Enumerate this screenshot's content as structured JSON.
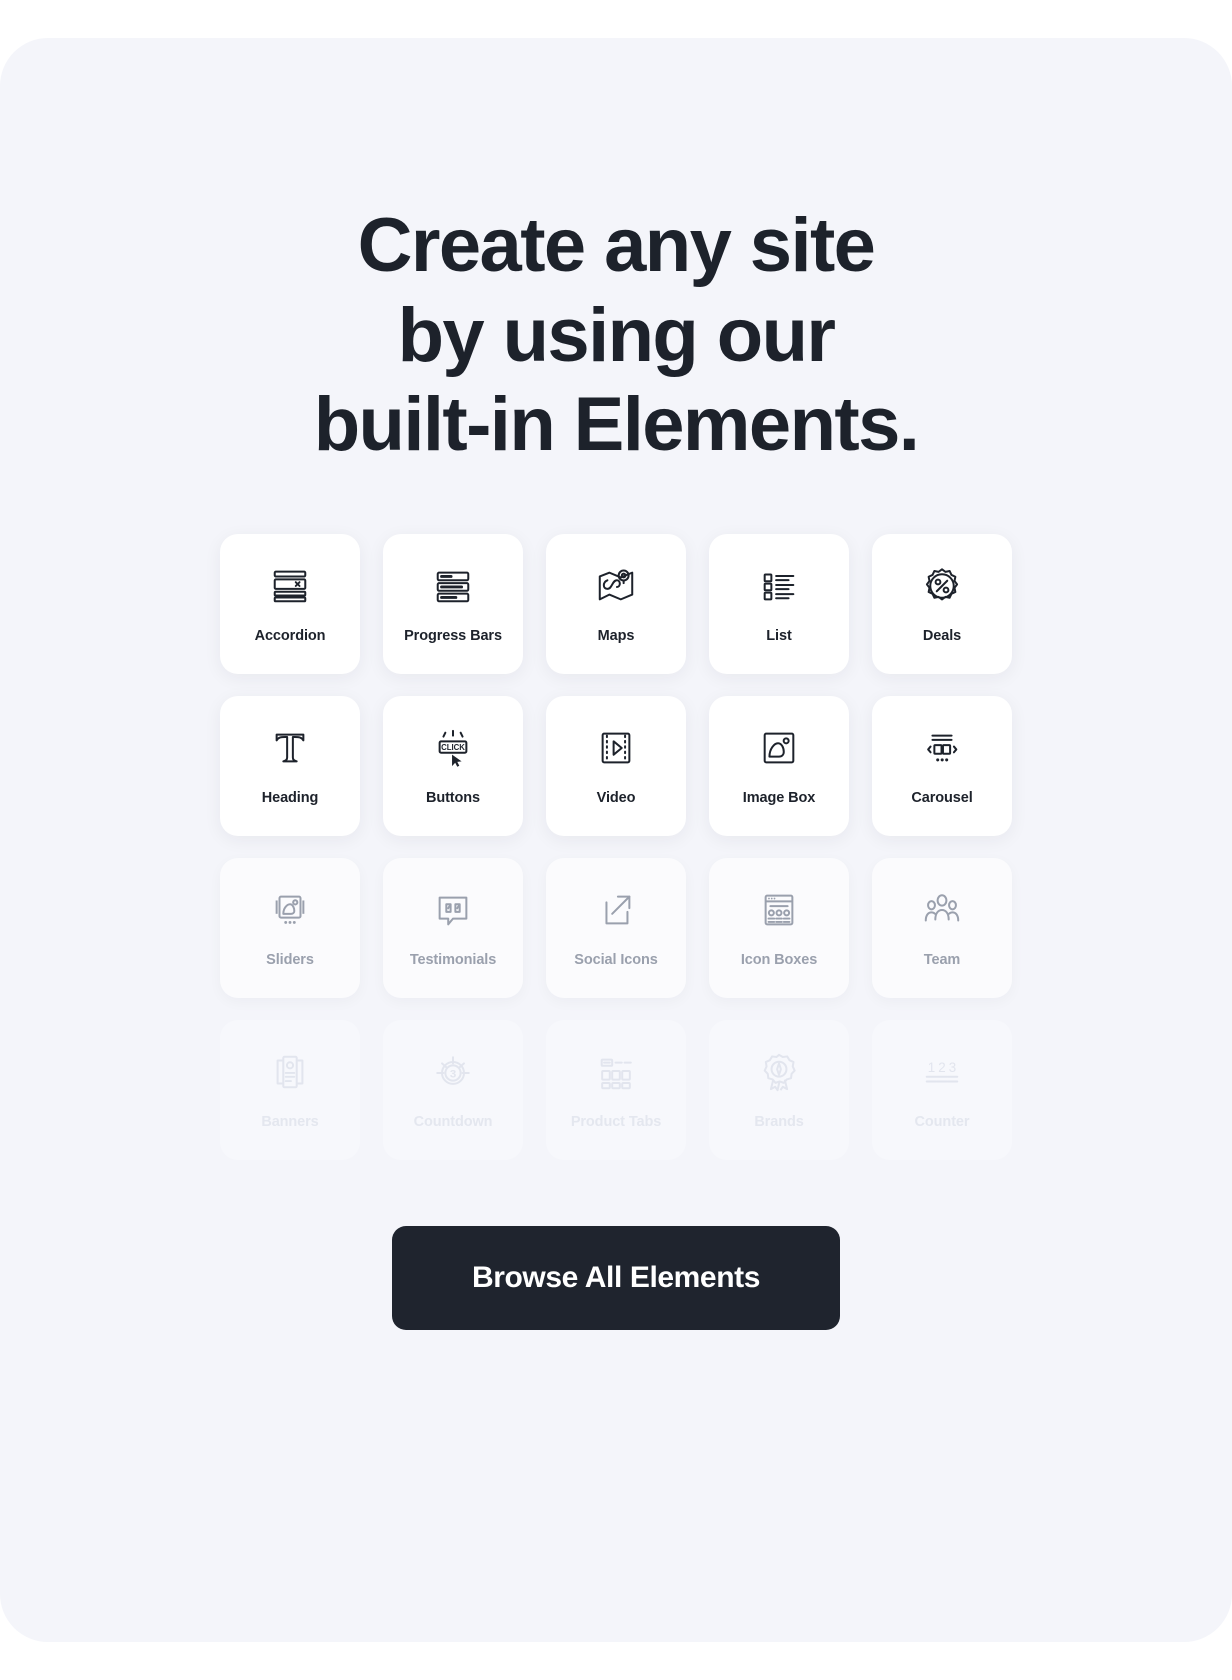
{
  "heading": {
    "line1": "Create any site",
    "line2": "by using our",
    "line3": "built-in Elements."
  },
  "colors": {
    "page_background": "#ffffff",
    "panel_background": "#f4f5fa",
    "card_background": "#ffffff",
    "text_primary": "#1d222b",
    "text_dimmed": "#9aa0ad",
    "text_faded": "#e4e7ef",
    "cta_background": "#1f242e",
    "cta_text": "#ffffff"
  },
  "grid": {
    "columns": 5,
    "rows": [
      {
        "opacity_state": "full",
        "items": [
          {
            "label": "Accordion",
            "icon": "accordion-icon"
          },
          {
            "label": "Progress Bars",
            "icon": "progress-bars-icon"
          },
          {
            "label": "Maps",
            "icon": "maps-icon"
          },
          {
            "label": "List",
            "icon": "list-icon"
          },
          {
            "label": "Deals",
            "icon": "deals-icon"
          }
        ]
      },
      {
        "opacity_state": "full",
        "items": [
          {
            "label": "Heading",
            "icon": "heading-icon"
          },
          {
            "label": "Buttons",
            "icon": "buttons-click-icon"
          },
          {
            "label": "Video",
            "icon": "video-icon"
          },
          {
            "label": "Image Box",
            "icon": "image-box-icon"
          },
          {
            "label": "Carousel",
            "icon": "carousel-icon"
          }
        ]
      },
      {
        "opacity_state": "dimmed",
        "items": [
          {
            "label": "Sliders",
            "icon": "sliders-icon"
          },
          {
            "label": "Testimonials",
            "icon": "testimonials-quote-icon"
          },
          {
            "label": "Social Icons",
            "icon": "social-icons-external-link-icon"
          },
          {
            "label": "Icon Boxes",
            "icon": "icon-boxes-icon"
          },
          {
            "label": "Team",
            "icon": "team-people-icon"
          }
        ]
      },
      {
        "opacity_state": "faded",
        "items": [
          {
            "label": "Banners",
            "icon": "banners-icon"
          },
          {
            "label": "Countdown",
            "icon": "countdown-icon"
          },
          {
            "label": "Product Tabs",
            "icon": "product-tabs-icon"
          },
          {
            "label": "Brands",
            "icon": "brands-badge-icon"
          },
          {
            "label": "Counter",
            "icon": "counter-123-icon"
          }
        ]
      }
    ]
  },
  "cta": {
    "label": "Browse All Elements"
  }
}
